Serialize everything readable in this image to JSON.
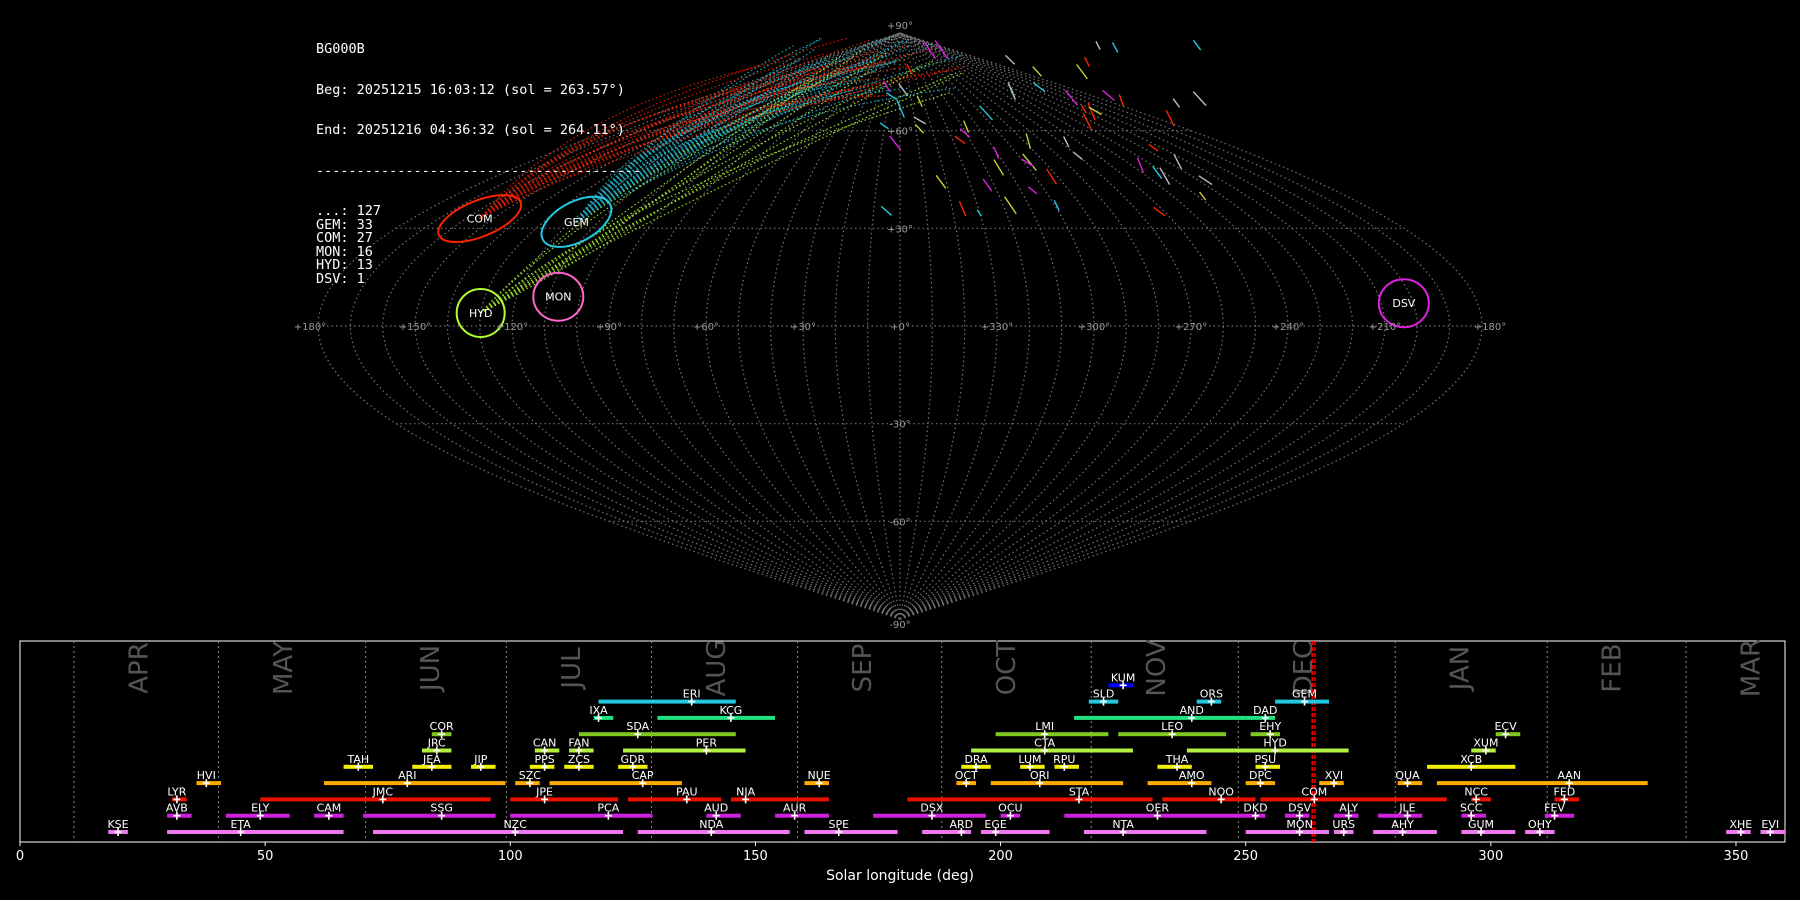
{
  "header": {
    "station": "BG000B",
    "beg": "Beg: 20251215 16:03:12 (sol = 263.57°)",
    "end": "End: 20251216 04:36:32 (sol = 264.11°)",
    "divider": "----------------------------------------"
  },
  "counts": [
    {
      "code": "...",
      "count": 127
    },
    {
      "code": "GEM",
      "count": 33
    },
    {
      "code": "COM",
      "count": 27
    },
    {
      "code": "MON",
      "count": 16
    },
    {
      "code": "HYD",
      "count": 13
    },
    {
      "code": "DSV",
      "count": 1
    }
  ],
  "map": {
    "lat_labels": [
      "+90°",
      "+60°",
      "+30°",
      "-30°",
      "-60°",
      "-90°"
    ],
    "lon_labels": [
      "+180°",
      "+150°",
      "+120°",
      "+90°",
      "+60°",
      "+30°",
      "+0°",
      "+330°",
      "+300°",
      "+270°",
      "+240°",
      "+210°",
      "+180°"
    ],
    "radiants": [
      {
        "name": "COM",
        "color": "#ff2200",
        "lon": 155,
        "lat": 33
      },
      {
        "name": "GEM",
        "color": "#22c8e0",
        "lon": 118,
        "lat": 32
      },
      {
        "name": "MON",
        "color": "#ff66cc",
        "lon": 107,
        "lat": 9
      },
      {
        "name": "HYD",
        "color": "#b0ff30",
        "lon": 130,
        "lat": 4
      },
      {
        "name": "DSV",
        "color": "#e020e0",
        "lon": 203,
        "lat": 7
      }
    ]
  },
  "chart_data": {
    "type": "timeline",
    "xlabel": "Solar longitude (deg)",
    "xlim": [
      0,
      360
    ],
    "xticks": [
      0,
      50,
      100,
      150,
      200,
      250,
      300,
      350
    ],
    "current_sol": [
      263.57,
      264.11
    ],
    "months": [
      {
        "name": "APR",
        "start": 11
      },
      {
        "name": "MAY",
        "start": 40.5
      },
      {
        "name": "JUN",
        "start": 70.5
      },
      {
        "name": "JUL",
        "start": 99.2
      },
      {
        "name": "AUG",
        "start": 128.8
      },
      {
        "name": "SEP",
        "start": 158.6
      },
      {
        "name": "OCT",
        "start": 188
      },
      {
        "name": "NOV",
        "start": 218.5
      },
      {
        "name": "DEC",
        "start": 248.5
      },
      {
        "name": "JAN",
        "start": 280.5
      },
      {
        "name": "FEB",
        "start": 311.5
      },
      {
        "name": "MAR",
        "start": 339.8
      }
    ],
    "showers": [
      {
        "code": "KUM",
        "start": 222,
        "end": 227,
        "peak": 225,
        "row": 9,
        "color": "#0000ff"
      },
      {
        "code": "ERI",
        "start": 118,
        "end": 146,
        "peak": 137,
        "row": 8,
        "color": "#22c8e0"
      },
      {
        "code": "SLD",
        "start": 218,
        "end": 224,
        "peak": 221,
        "row": 8,
        "color": "#22c8e0"
      },
      {
        "code": "ORS",
        "start": 240,
        "end": 245,
        "peak": 243,
        "row": 8,
        "color": "#22c8e0"
      },
      {
        "code": "GEM",
        "start": 256,
        "end": 267,
        "peak": 262,
        "row": 8,
        "color": "#22c8e0"
      },
      {
        "code": "IXA",
        "start": 117,
        "end": 121,
        "peak": 118,
        "row": 7,
        "color": "#22e080"
      },
      {
        "code": "KCG",
        "start": 130,
        "end": 154,
        "peak": 145,
        "row": 7,
        "color": "#22e080"
      },
      {
        "code": "AND",
        "start": 215,
        "end": 250,
        "peak": 239,
        "row": 7,
        "color": "#22e080"
      },
      {
        "code": "DAD",
        "start": 250,
        "end": 256,
        "peak": 254,
        "row": 7,
        "color": "#22e080"
      },
      {
        "code": "COR",
        "start": 84,
        "end": 88,
        "peak": 86,
        "row": 6,
        "color": "#7ec820"
      },
      {
        "code": "SDA",
        "start": 114,
        "end": 146,
        "peak": 126,
        "row": 6,
        "color": "#7ec820"
      },
      {
        "code": "LMI",
        "start": 199,
        "end": 222,
        "peak": 209,
        "row": 6,
        "color": "#7ec820"
      },
      {
        "code": "LEO",
        "start": 224,
        "end": 246,
        "peak": 235,
        "row": 6,
        "color": "#7ec820"
      },
      {
        "code": "EHY",
        "start": 251,
        "end": 257,
        "peak": 255,
        "row": 6,
        "color": "#7ec820"
      },
      {
        "code": "ECV",
        "start": 301,
        "end": 306,
        "peak": 303,
        "row": 6,
        "color": "#7ec820"
      },
      {
        "code": "JRC",
        "start": 82,
        "end": 88,
        "peak": 85,
        "row": 5,
        "color": "#b0f040"
      },
      {
        "code": "CAN",
        "start": 105,
        "end": 110,
        "peak": 107,
        "row": 5,
        "color": "#b0f040"
      },
      {
        "code": "FAN",
        "start": 112,
        "end": 117,
        "peak": 114,
        "row": 5,
        "color": "#b0f040"
      },
      {
        "code": "PER",
        "start": 123,
        "end": 148,
        "peak": 140,
        "row": 5,
        "color": "#b0f040"
      },
      {
        "code": "CTA",
        "start": 194,
        "end": 227,
        "peak": 209,
        "row": 5,
        "color": "#b0f040"
      },
      {
        "code": "HYD",
        "start": 238,
        "end": 271,
        "peak": 256,
        "row": 5,
        "color": "#b0f040"
      },
      {
        "code": "XUM",
        "start": 296,
        "end": 301,
        "peak": 299,
        "row": 5,
        "color": "#b0f040"
      },
      {
        "code": "TAH",
        "start": 66,
        "end": 72,
        "peak": 69,
        "row": 4,
        "color": "#f0f000"
      },
      {
        "code": "JEA",
        "start": 80,
        "end": 88,
        "peak": 84,
        "row": 4,
        "color": "#f0f000"
      },
      {
        "code": "JIP",
        "start": 92,
        "end": 97,
        "peak": 94,
        "row": 4,
        "color": "#f0f000"
      },
      {
        "code": "PPS",
        "start": 104,
        "end": 109,
        "peak": 107,
        "row": 4,
        "color": "#f0f000"
      },
      {
        "code": "ZCS",
        "start": 111,
        "end": 117,
        "peak": 114,
        "row": 4,
        "color": "#f0f000"
      },
      {
        "code": "GDR",
        "start": 122,
        "end": 128,
        "peak": 125,
        "row": 4,
        "color": "#f0f000"
      },
      {
        "code": "DRA",
        "start": 192,
        "end": 198,
        "peak": 195,
        "row": 4,
        "color": "#f0f000"
      },
      {
        "code": "LUM",
        "start": 204,
        "end": 209,
        "peak": 206,
        "row": 4,
        "color": "#f0f000"
      },
      {
        "code": "RPU",
        "start": 211,
        "end": 216,
        "peak": 213,
        "row": 4,
        "color": "#f0f000"
      },
      {
        "code": "THA",
        "start": 232,
        "end": 239,
        "peak": 236,
        "row": 4,
        "color": "#f0f000"
      },
      {
        "code": "PSU",
        "start": 252,
        "end": 257,
        "peak": 254,
        "row": 4,
        "color": "#f0f000"
      },
      {
        "code": "XCB",
        "start": 287,
        "end": 305,
        "peak": 296,
        "row": 4,
        "color": "#f0f000"
      },
      {
        "code": "HVI",
        "start": 36,
        "end": 41,
        "peak": 38,
        "row": 3,
        "color": "#ffaa00"
      },
      {
        "code": "ARI",
        "start": 62,
        "end": 99,
        "peak": 79,
        "row": 3,
        "color": "#ffaa00"
      },
      {
        "code": "SZC",
        "start": 101,
        "end": 106,
        "peak": 104,
        "row": 3,
        "color": "#ffaa00"
      },
      {
        "code": "CAP",
        "start": 108,
        "end": 135,
        "peak": 127,
        "row": 3,
        "color": "#ffaa00"
      },
      {
        "code": "NUE",
        "start": 160,
        "end": 165,
        "peak": 163,
        "row": 3,
        "color": "#ffaa00"
      },
      {
        "code": "OCT",
        "start": 191,
        "end": 195,
        "peak": 193,
        "row": 3,
        "color": "#ffaa00"
      },
      {
        "code": "ORI",
        "start": 198,
        "end": 225,
        "peak": 208,
        "row": 3,
        "color": "#ffaa00"
      },
      {
        "code": "AMO",
        "start": 230,
        "end": 243,
        "peak": 239,
        "row": 3,
        "color": "#ffaa00"
      },
      {
        "code": "DPC",
        "start": 250,
        "end": 256,
        "peak": 253,
        "row": 3,
        "color": "#ffaa00"
      },
      {
        "code": "XVI",
        "start": 265,
        "end": 270,
        "peak": 268,
        "row": 3,
        "color": "#ffaa00"
      },
      {
        "code": "QUA",
        "start": 281,
        "end": 286,
        "peak": 283,
        "row": 3,
        "color": "#ffaa00"
      },
      {
        "code": "AAN",
        "start": 289,
        "end": 332,
        "peak": 316,
        "row": 3,
        "color": "#ffaa00"
      },
      {
        "code": "LYR",
        "start": 31,
        "end": 34,
        "peak": 32,
        "row": 2,
        "color": "#ee1100"
      },
      {
        "code": "JMC",
        "start": 49,
        "end": 96,
        "peak": 74,
        "row": 2,
        "color": "#ee1100"
      },
      {
        "code": "JPE",
        "start": 100,
        "end": 122,
        "peak": 107,
        "row": 2,
        "color": "#ee1100"
      },
      {
        "code": "PAU",
        "start": 124,
        "end": 143,
        "peak": 136,
        "row": 2,
        "color": "#ee1100"
      },
      {
        "code": "NIA",
        "start": 145,
        "end": 165,
        "peak": 148,
        "row": 2,
        "color": "#ee1100"
      },
      {
        "code": "STA",
        "start": 181,
        "end": 231,
        "peak": 216,
        "row": 2,
        "color": "#ee1100"
      },
      {
        "code": "NOO",
        "start": 233,
        "end": 252,
        "peak": 245,
        "row": 2,
        "color": "#ee1100"
      },
      {
        "code": "COM",
        "start": 253,
        "end": 291,
        "peak": 264,
        "row": 2,
        "color": "#ee1100"
      },
      {
        "code": "NCC",
        "start": 296,
        "end": 300,
        "peak": 297,
        "row": 2,
        "color": "#ee1100"
      },
      {
        "code": "FED",
        "start": 313,
        "end": 318,
        "peak": 315,
        "row": 2,
        "color": "#ee1100"
      },
      {
        "code": "AVB",
        "start": 30,
        "end": 35,
        "peak": 32,
        "row": 1,
        "color": "#cc22dd"
      },
      {
        "code": "ELY",
        "start": 42,
        "end": 55,
        "peak": 49,
        "row": 1,
        "color": "#cc22dd"
      },
      {
        "code": "CAM",
        "start": 60,
        "end": 66,
        "peak": 63,
        "row": 1,
        "color": "#cc22dd"
      },
      {
        "code": "SSG",
        "start": 70,
        "end": 97,
        "peak": 86,
        "row": 1,
        "color": "#cc22dd"
      },
      {
        "code": "PCA",
        "start": 100,
        "end": 129,
        "peak": 120,
        "row": 1,
        "color": "#cc22dd"
      },
      {
        "code": "AUD",
        "start": 140,
        "end": 147,
        "peak": 142,
        "row": 1,
        "color": "#cc22dd"
      },
      {
        "code": "AUR",
        "start": 154,
        "end": 165,
        "peak": 158,
        "row": 1,
        "color": "#cc22dd"
      },
      {
        "code": "DSX",
        "start": 174,
        "end": 197,
        "peak": 186,
        "row": 1,
        "color": "#cc22dd"
      },
      {
        "code": "OCU",
        "start": 200,
        "end": 204,
        "peak": 202,
        "row": 1,
        "color": "#cc22dd"
      },
      {
        "code": "OER",
        "start": 213,
        "end": 250,
        "peak": 232,
        "row": 1,
        "color": "#cc22dd"
      },
      {
        "code": "DKD",
        "start": 250,
        "end": 254,
        "peak": 252,
        "row": 1,
        "color": "#cc22dd"
      },
      {
        "code": "DSV",
        "start": 258,
        "end": 263,
        "peak": 261,
        "row": 1,
        "color": "#cc22dd"
      },
      {
        "code": "ALY",
        "start": 268,
        "end": 273,
        "peak": 271,
        "row": 1,
        "color": "#cc22dd"
      },
      {
        "code": "JLE",
        "start": 277,
        "end": 286,
        "peak": 283,
        "row": 1,
        "color": "#cc22dd"
      },
      {
        "code": "SCC",
        "start": 294,
        "end": 299,
        "peak": 296,
        "row": 1,
        "color": "#cc22dd"
      },
      {
        "code": "FEV",
        "start": 311,
        "end": 317,
        "peak": 313,
        "row": 1,
        "color": "#cc22dd"
      },
      {
        "code": "KSE",
        "start": 18,
        "end": 22,
        "peak": 20,
        "row": 0,
        "color": "#ee77ee"
      },
      {
        "code": "ETA",
        "start": 30,
        "end": 66,
        "peak": 45,
        "row": 0,
        "color": "#ee77ee"
      },
      {
        "code": "NZC",
        "start": 72,
        "end": 123,
        "peak": 101,
        "row": 0,
        "color": "#ee77ee"
      },
      {
        "code": "NDA",
        "start": 126,
        "end": 157,
        "peak": 141,
        "row": 0,
        "color": "#ee77ee"
      },
      {
        "code": "SPE",
        "start": 160,
        "end": 179,
        "peak": 167,
        "row": 0,
        "color": "#ee77ee"
      },
      {
        "code": "ARD",
        "start": 184,
        "end": 194,
        "peak": 192,
        "row": 0,
        "color": "#ee77ee"
      },
      {
        "code": "EGE",
        "start": 196,
        "end": 210,
        "peak": 199,
        "row": 0,
        "color": "#ee77ee"
      },
      {
        "code": "NTA",
        "start": 217,
        "end": 242,
        "peak": 225,
        "row": 0,
        "color": "#ee77ee"
      },
      {
        "code": "MON",
        "start": 250,
        "end": 267,
        "peak": 261,
        "row": 0,
        "color": "#ee77ee"
      },
      {
        "code": "URS",
        "start": 268,
        "end": 272,
        "peak": 270,
        "row": 0,
        "color": "#ee77ee"
      },
      {
        "code": "AHY",
        "start": 276,
        "end": 289,
        "peak": 282,
        "row": 0,
        "color": "#ee77ee"
      },
      {
        "code": "GUM",
        "start": 294,
        "end": 305,
        "peak": 298,
        "row": 0,
        "color": "#ee77ee"
      },
      {
        "code": "OHY",
        "start": 307,
        "end": 313,
        "peak": 310,
        "row": 0,
        "color": "#ee77ee"
      },
      {
        "code": "XHE",
        "start": 348,
        "end": 353,
        "peak": 351,
        "row": 0,
        "color": "#ee77ee"
      },
      {
        "code": "EVI",
        "start": 355,
        "end": 360,
        "peak": 357,
        "row": 0,
        "color": "#ee77ee"
      }
    ]
  }
}
